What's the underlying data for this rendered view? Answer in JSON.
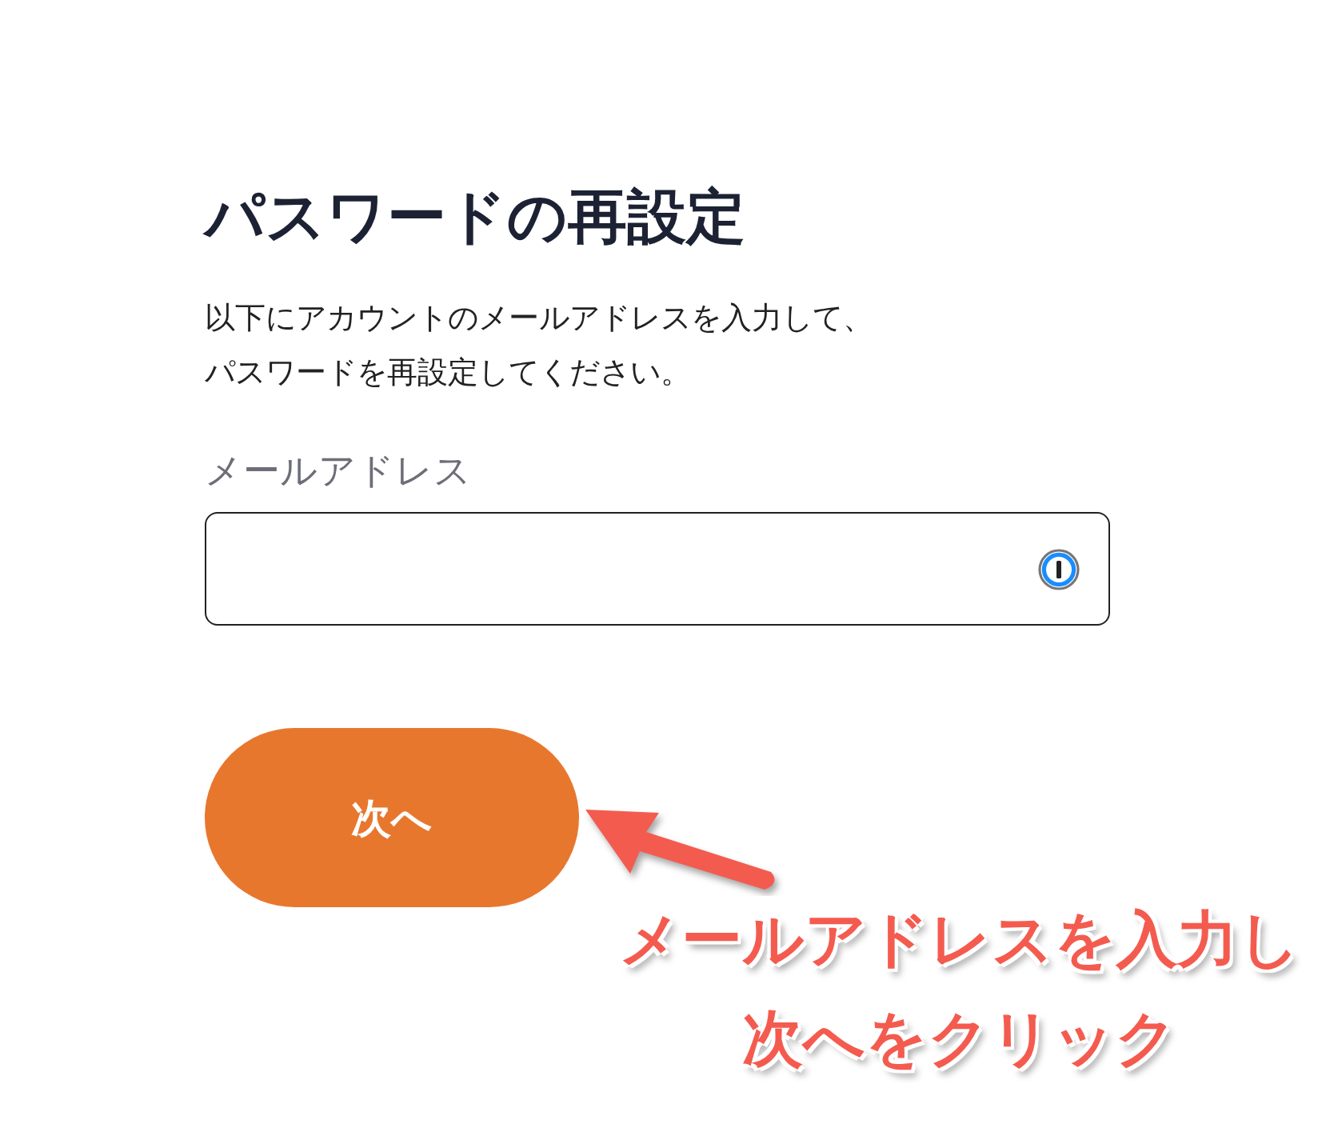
{
  "title": "パスワードの再設定",
  "description_lines": [
    "以下にアカウントのメールアドレスを入力して、",
    "パスワードを再設定してください。"
  ],
  "email_field": {
    "label": "メールアドレス"
  },
  "next_button": {
    "label": "次へ"
  },
  "annotation": {
    "lines": [
      "メールアドレスを入力し",
      "次へをクリック"
    ]
  }
}
